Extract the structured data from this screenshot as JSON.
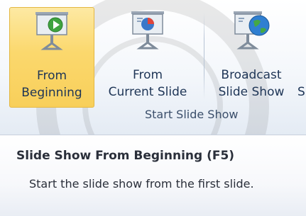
{
  "ribbon": {
    "buttons": [
      {
        "label_line1": "From",
        "label_line2": "Beginning",
        "icon": "presentation-screen-play-icon",
        "state": "hover"
      },
      {
        "label_line1": "From",
        "label_line2": "Current Slide",
        "icon": "presentation-screen-slide-icon"
      },
      {
        "label_line1": "Broadcast",
        "label_line2": "Slide Show",
        "icon": "presentation-screen-globe-icon"
      }
    ],
    "overflow_label": "S",
    "group_label": "Start Slide Show"
  },
  "tooltip": {
    "title": "Slide Show From Beginning (F5)",
    "description": "Start the slide show from the first slide."
  },
  "colors": {
    "hover_highlight": "#fbd86d",
    "ribbon_text": "#1e3556"
  }
}
